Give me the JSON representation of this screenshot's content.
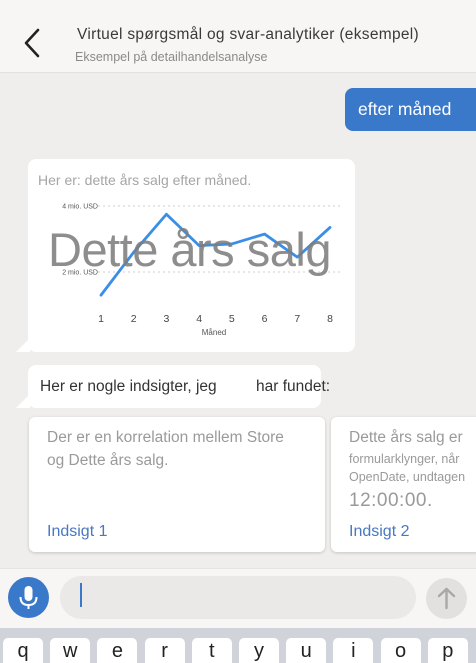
{
  "header": {
    "title": "Virtuel spørgsmål og svar-analytiker (eksempel)",
    "subtitle": "Eksempel på detailhandelsanalyse"
  },
  "user_message": "efter måned",
  "chart_intro": "Her er: dette års salg efter måned.",
  "overlay_title": "Dette års salg",
  "chart_data": {
    "type": "line",
    "title": "Dette års salg",
    "x": [
      1,
      2,
      3,
      4,
      5,
      6,
      7,
      8
    ],
    "xlabel": "Måned",
    "ylabel": "",
    "y_tick_labels": [
      "4 mio. USD",
      "2 mio. USD"
    ],
    "y_ticks": [
      4,
      2
    ],
    "ylim": [
      0,
      4.5
    ],
    "series": [
      {
        "values": [
          1.3,
          2.6,
          3.75,
          2.8,
          2.85,
          3.15,
          2.45,
          3.35
        ]
      }
    ],
    "grid": true,
    "color": "#3a8ee6"
  },
  "insight_message": {
    "part_a": "Her er nogle indsigter, jeg",
    "part_b": "har fundet:"
  },
  "insights": [
    {
      "line1": "Der er en korrelation mellem Store",
      "line2": "og Dette års salg.",
      "link": "Indsigt 1"
    },
    {
      "line1": "Dette års salg er",
      "line2": "formularklynger, når",
      "line3": "OpenDate, undtagen",
      "line4": "12:00:00.",
      "link": "Indsigt 2"
    }
  ],
  "input": {
    "value": "",
    "placeholder": ""
  },
  "keyboard": {
    "keys": [
      "q",
      "w",
      "e",
      "r",
      "t",
      "y",
      "u",
      "i",
      "o",
      "p"
    ]
  },
  "colors": {
    "accent": "#3a78c9",
    "line": "#3a8ee6",
    "link": "#4878c2"
  }
}
